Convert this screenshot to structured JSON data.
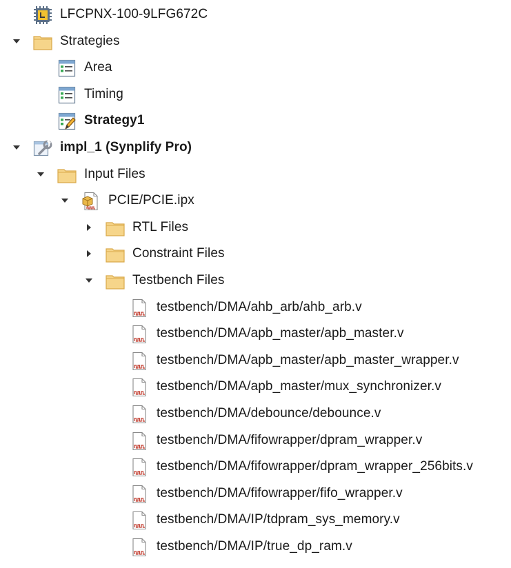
{
  "tree": {
    "nodes": [
      {
        "id": "device",
        "label": "LFCPNX-100-9LFG672C",
        "icon": "chip-icon",
        "bold": false,
        "toggle": "none"
      },
      {
        "id": "strategies",
        "label": "Strategies",
        "icon": "folder-icon",
        "bold": false,
        "toggle": "expanded"
      },
      {
        "id": "strategy-area",
        "label": "Area",
        "icon": "strategy-icon",
        "bold": false,
        "toggle": "none"
      },
      {
        "id": "strategy-timing",
        "label": "Timing",
        "icon": "strategy-icon",
        "bold": false,
        "toggle": "none"
      },
      {
        "id": "strategy-1",
        "label": "Strategy1",
        "icon": "strategy-edit-icon",
        "bold": true,
        "toggle": "none"
      },
      {
        "id": "impl",
        "label": "impl_1 (Synplify Pro)",
        "icon": "implementation-icon",
        "bold": true,
        "toggle": "expanded"
      },
      {
        "id": "input-files",
        "label": "Input Files",
        "icon": "folder-icon",
        "bold": false,
        "toggle": "expanded"
      },
      {
        "id": "ipx",
        "label": "PCIE/PCIE.ipx",
        "icon": "ip-file-icon",
        "bold": false,
        "toggle": "expanded"
      },
      {
        "id": "rtl-files",
        "label": "RTL Files",
        "icon": "folder-icon",
        "bold": false,
        "toggle": "collapsed"
      },
      {
        "id": "constraint-files",
        "label": "Constraint Files",
        "icon": "folder-icon",
        "bold": false,
        "toggle": "collapsed"
      },
      {
        "id": "testbench-files",
        "label": "Testbench Files",
        "icon": "folder-icon",
        "bold": false,
        "toggle": "expanded"
      },
      {
        "id": "tb-1",
        "label": "testbench/DMA/ahb_arb/ahb_arb.v",
        "icon": "verilog-file-icon",
        "bold": false,
        "toggle": "none"
      },
      {
        "id": "tb-2",
        "label": "testbench/DMA/apb_master/apb_master.v",
        "icon": "verilog-file-icon",
        "bold": false,
        "toggle": "none"
      },
      {
        "id": "tb-3",
        "label": "testbench/DMA/apb_master/apb_master_wrapper.v",
        "icon": "verilog-file-icon",
        "bold": false,
        "toggle": "none"
      },
      {
        "id": "tb-4",
        "label": "testbench/DMA/apb_master/mux_synchronizer.v",
        "icon": "verilog-file-icon",
        "bold": false,
        "toggle": "none"
      },
      {
        "id": "tb-5",
        "label": "testbench/DMA/debounce/debounce.v",
        "icon": "verilog-file-icon",
        "bold": false,
        "toggle": "none"
      },
      {
        "id": "tb-6",
        "label": "testbench/DMA/fifowrapper/dpram_wrapper.v",
        "icon": "verilog-file-icon",
        "bold": false,
        "toggle": "none"
      },
      {
        "id": "tb-7",
        "label": "testbench/DMA/fifowrapper/dpram_wrapper_256bits.v",
        "icon": "verilog-file-icon",
        "bold": false,
        "toggle": "none"
      },
      {
        "id": "tb-8",
        "label": "testbench/DMA/fifowrapper/fifo_wrapper.v",
        "icon": "verilog-file-icon",
        "bold": false,
        "toggle": "none"
      },
      {
        "id": "tb-9",
        "label": "testbench/DMA/IP/tdpram_sys_memory.v",
        "icon": "verilog-file-icon",
        "bold": false,
        "toggle": "none"
      },
      {
        "id": "tb-10",
        "label": "testbench/DMA/IP/true_dp_ram.v",
        "icon": "verilog-file-icon",
        "bold": false,
        "toggle": "none"
      }
    ]
  },
  "colors": {
    "folder": "#f6d58a",
    "folder_edge": "#d9a94a",
    "chip": "#5b6f86",
    "chip_core": "#f2c230",
    "file_wave": "#c0392b",
    "arrow": "#333333"
  }
}
